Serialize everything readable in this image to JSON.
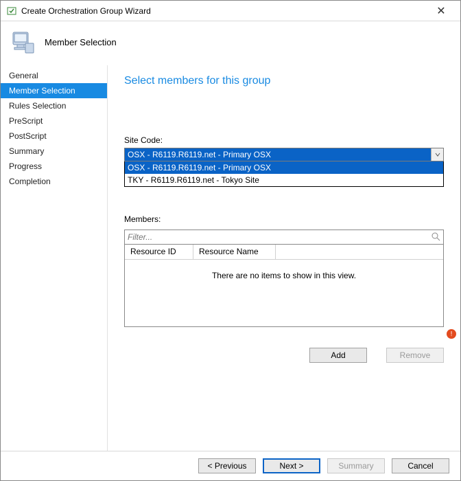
{
  "window": {
    "title": "Create Orchestration Group Wizard",
    "close_glyph": "✕"
  },
  "header": {
    "step_title": "Member Selection"
  },
  "sidebar": {
    "items": [
      {
        "label": "General",
        "selected": false
      },
      {
        "label": "Member Selection",
        "selected": true
      },
      {
        "label": "Rules Selection",
        "selected": false
      },
      {
        "label": "PreScript",
        "selected": false
      },
      {
        "label": "PostScript",
        "selected": false
      },
      {
        "label": "Summary",
        "selected": false
      },
      {
        "label": "Progress",
        "selected": false
      },
      {
        "label": "Completion",
        "selected": false
      }
    ]
  },
  "content": {
    "page_title": "Select members for this group",
    "site_code_label": "Site Code:",
    "site_code_selected": "OSX - R6119.R6119.net - Primary OSX",
    "site_code_options": [
      {
        "label": "OSX - R6119.R6119.net - Primary OSX",
        "selected": true
      },
      {
        "label": "TKY - R6119.R6119.net - Tokyo Site",
        "selected": false
      }
    ],
    "members_label": "Members:",
    "filter_placeholder": "Filter...",
    "columns": {
      "resource_id": "Resource ID",
      "resource_name": "Resource Name"
    },
    "empty_message": "There are no items to show in this view.",
    "rows": [],
    "add_label": "Add",
    "remove_label": "Remove"
  },
  "footer": {
    "previous": "< Previous",
    "next": "Next >",
    "summary": "Summary",
    "cancel": "Cancel"
  }
}
